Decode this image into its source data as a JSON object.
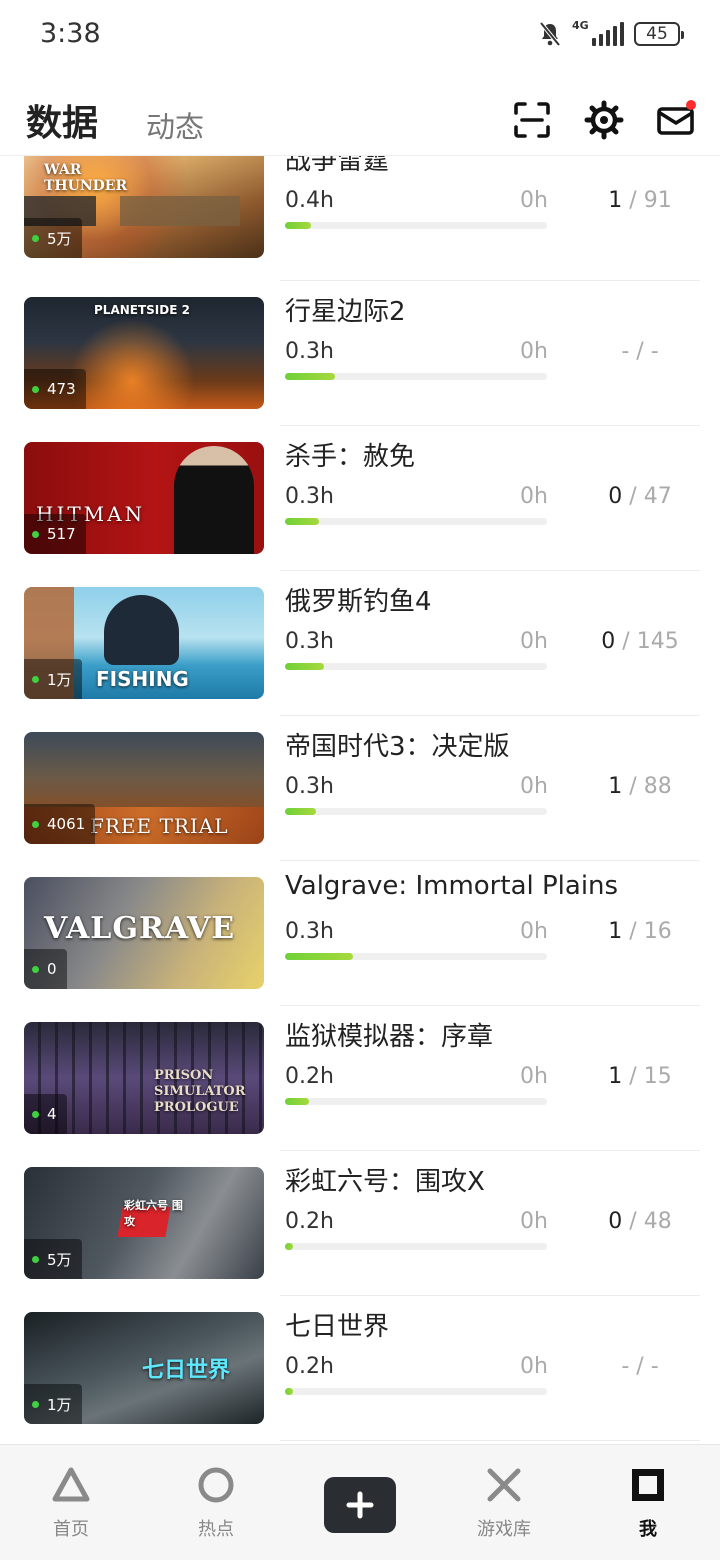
{
  "status": {
    "time": "3:38",
    "battery": "45",
    "network": "4G"
  },
  "header": {
    "tab_active": "数据",
    "tab_inactive": "动态",
    "icons": [
      "scan-icon",
      "gear-icon",
      "mail-icon"
    ],
    "mail_has_notification": true
  },
  "games": [
    {
      "name": "战争雷霆",
      "hours": "0.4h",
      "recent": "0h",
      "ach_done": "1",
      "ach_total": "/ 91",
      "online": "5万",
      "progress": 0.1,
      "thumb_text": "WAR THUNDER"
    },
    {
      "name": "行星边际2",
      "hours": "0.3h",
      "recent": "0h",
      "ach_done": "",
      "ach_total": "- / -",
      "online": "473",
      "progress": 0.19,
      "thumb_text": "PLANETSIDE 2"
    },
    {
      "name": "杀手：赦免",
      "hours": "0.3h",
      "recent": "0h",
      "ach_done": "0",
      "ach_total": "/ 47",
      "online": "517",
      "progress": 0.13,
      "thumb_text": "HITMAN"
    },
    {
      "name": "俄罗斯钓鱼4",
      "hours": "0.3h",
      "recent": "0h",
      "ach_done": "0",
      "ach_total": "/ 145",
      "online": "1万",
      "progress": 0.15,
      "thumb_text": "FISHING"
    },
    {
      "name": "帝国时代3：决定版",
      "hours": "0.3h",
      "recent": "0h",
      "ach_done": "1",
      "ach_total": "/ 88",
      "online": "4061",
      "progress": 0.12,
      "thumb_text": "FREE TRIAL"
    },
    {
      "name": "Valgrave: Immortal Plains",
      "hours": "0.3h",
      "recent": "0h",
      "ach_done": "1",
      "ach_total": "/ 16",
      "online": "0",
      "progress": 0.26,
      "thumb_text": "VALGRAVE"
    },
    {
      "name": "监狱模拟器：序章",
      "hours": "0.2h",
      "recent": "0h",
      "ach_done": "1",
      "ach_total": "/ 15",
      "online": "4",
      "progress": 0.09,
      "thumb_text": "PRISON SIMULATOR PROLOGUE"
    },
    {
      "name": "彩虹六号：围攻X",
      "hours": "0.2h",
      "recent": "0h",
      "ach_done": "0",
      "ach_total": "/ 48",
      "online": "5万",
      "progress": 0.03,
      "thumb_text": "彩虹六号 围攻"
    },
    {
      "name": "七日世界",
      "hours": "0.2h",
      "recent": "0h",
      "ach_done": "",
      "ach_total": "- / -",
      "online": "1万",
      "progress": 0.03,
      "thumb_text": "七日世界"
    }
  ],
  "nav": {
    "home": "首页",
    "hot": "热点",
    "library": "游戏库",
    "me": "我"
  },
  "colors": {
    "accent": "#7dd23a",
    "online": "#3fd13f",
    "notify": "#ff2d2d"
  }
}
